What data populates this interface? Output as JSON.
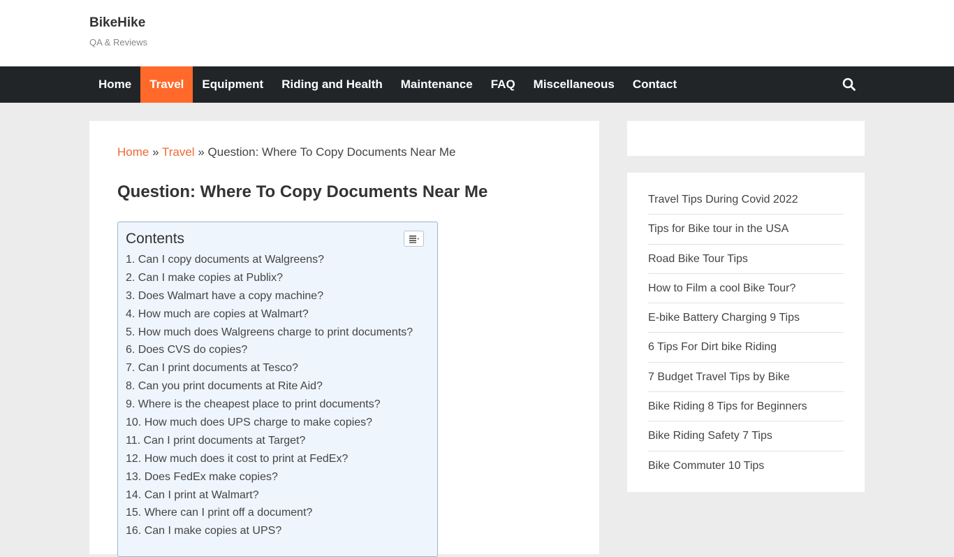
{
  "site": {
    "title": "BikeHike",
    "tagline": "QA & Reviews"
  },
  "nav": {
    "items": [
      {
        "label": "Home",
        "active": false
      },
      {
        "label": "Travel",
        "active": true
      },
      {
        "label": "Equipment",
        "active": false
      },
      {
        "label": "Riding and Health",
        "active": false
      },
      {
        "label": "Maintenance",
        "active": false
      },
      {
        "label": "FAQ",
        "active": false
      },
      {
        "label": "Miscellaneous",
        "active": false
      },
      {
        "label": "Contact",
        "active": false
      }
    ],
    "search_icon": "search-icon",
    "bar_color": "#222527",
    "active_color": "#ff6a2b"
  },
  "breadcrumb": {
    "home": "Home",
    "sep1": "»",
    "travel": "Travel",
    "sep2": "»",
    "current": "Question: Where To Copy Documents Near Me",
    "link_color": "#ee6a35"
  },
  "article": {
    "title": "Question: Where To Copy Documents Near Me"
  },
  "toc": {
    "title": "Contents",
    "toggle_icon": "list-toggle-icon",
    "items": [
      "1. Can I copy documents at Walgreens?",
      "2. Can I make copies at Publix?",
      "3. Does Walmart have a copy machine?",
      "4. How much are copies at Walmart?",
      "5. How much does Walgreens charge to print documents?",
      "6. Does CVS do copies?",
      "7. Can I print documents at Tesco?",
      "8. Can you print documents at Rite Aid?",
      "9. Where is the cheapest place to print documents?",
      "10. How much does UPS charge to make copies?",
      "11. Can I print documents at Target?",
      "12. How much does it cost to print at FedEx?",
      "13. Does FedEx make copies?",
      "14. Can I print at Walmart?",
      "15. Where can I print off a document?",
      "16. Can I make copies at UPS?"
    ]
  },
  "sidebar": {
    "posts": [
      "Travel Tips During Covid 2022",
      "Tips for Bike tour in the USA",
      "Road Bike Tour Tips",
      "How to Film a cool Bike Tour?",
      "E-bike Battery Charging 9 Tips",
      "6 Tips For Dirt bike Riding",
      "7 Budget Travel Tips by Bike",
      "Bike Riding 8 Tips for Beginners",
      "Bike Riding Safety 7 Tips",
      "Bike Commuter 10 Tips"
    ]
  }
}
